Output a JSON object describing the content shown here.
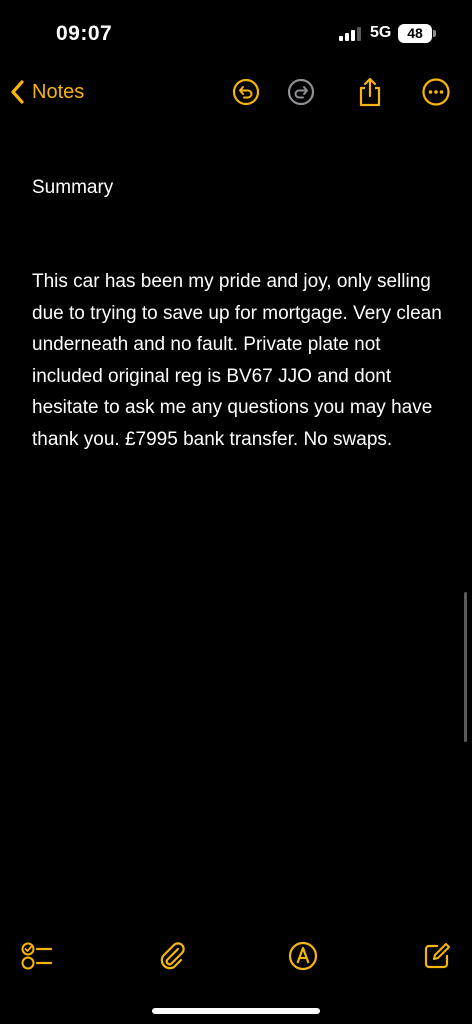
{
  "status_bar": {
    "time": "09:07",
    "network": "5G",
    "battery": "48"
  },
  "nav": {
    "back_label": "Notes",
    "icons": [
      "undo-icon",
      "redo-icon",
      "share-icon",
      "more-icon"
    ]
  },
  "note": {
    "title": "Summary",
    "body": "This car has been my pride and joy, only selling due to trying to save up for mortgage. Very clean underneath and no fault. Private plate not included original reg is BV67 JJO and dont hesitate to ask me any questions you may have thank you. £7995 bank transfer. No swaps."
  },
  "toolbar": {
    "icons": [
      "checklist-icon",
      "attachment-icon",
      "markup-icon",
      "compose-icon"
    ]
  },
  "colors": {
    "accent": "#f5b50a",
    "background": "#000000",
    "text": "#ffffff",
    "disabled": "#8e8e93"
  }
}
